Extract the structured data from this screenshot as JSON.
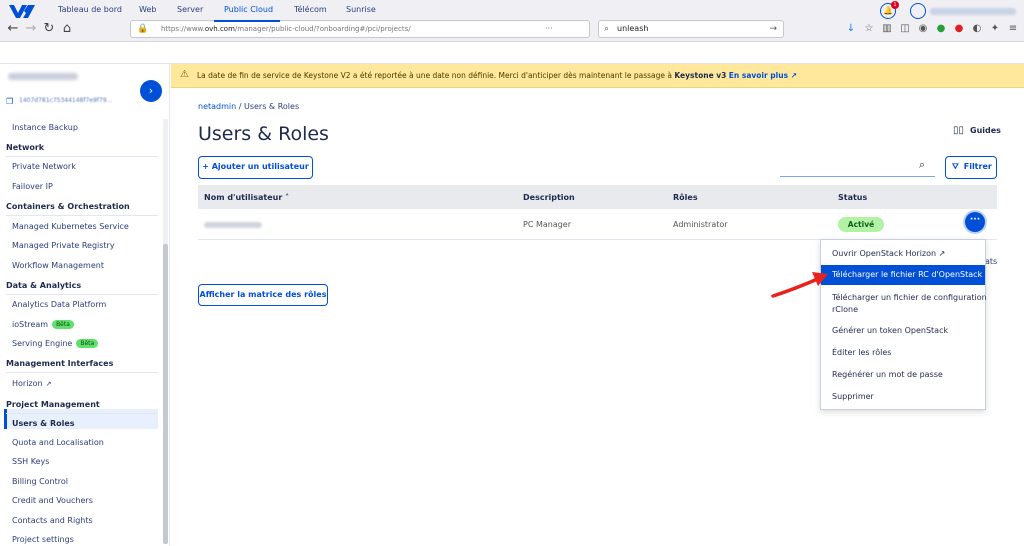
{
  "browser": {
    "url_prefix": "https://www.",
    "url_domain": "ovh.com",
    "url_rest": "/manager/public-cloud/?onboarding#/pci/projects/",
    "url_tail": "···",
    "search_value": "unleash"
  },
  "topnav": {
    "items": [
      "Tableau de bord",
      "Web",
      "Server",
      "Public Cloud",
      "Télécom",
      "Sunrise"
    ],
    "notif_count": "1"
  },
  "sidebar": {
    "toggle": "›",
    "project_id": "1407d781c75344148f7e9f79...",
    "items": [
      {
        "type": "item",
        "label": "Instance Backup"
      },
      {
        "type": "section",
        "label": "Network"
      },
      {
        "type": "item",
        "label": "Private Network"
      },
      {
        "type": "item",
        "label": "Failover IP"
      },
      {
        "type": "section",
        "label": "Containers & Orchestration"
      },
      {
        "type": "item",
        "label": "Managed Kubernetes Service"
      },
      {
        "type": "item",
        "label": "Managed Private Registry"
      },
      {
        "type": "item",
        "label": "Workflow Management"
      },
      {
        "type": "section",
        "label": "Data & Analytics"
      },
      {
        "type": "item",
        "label": "Analytics Data Platform"
      },
      {
        "type": "item",
        "label": "ioStream",
        "badge": "Bêta"
      },
      {
        "type": "item",
        "label": "Serving Engine",
        "badge": "Bêta"
      },
      {
        "type": "section",
        "label": "Management Interfaces"
      },
      {
        "type": "item",
        "label": "Horizon",
        "external": "↗"
      },
      {
        "type": "section",
        "label": "Project Management"
      },
      {
        "type": "item",
        "label": "Users & Roles",
        "active": true
      },
      {
        "type": "item",
        "label": "Quota and Localisation"
      },
      {
        "type": "item",
        "label": "SSH Keys"
      },
      {
        "type": "item",
        "label": "Billing Control"
      },
      {
        "type": "item",
        "label": "Credit and Vouchers"
      },
      {
        "type": "item",
        "label": "Contacts and Rights"
      },
      {
        "type": "item",
        "label": "Project settings"
      }
    ]
  },
  "banner": {
    "icon": "⚠",
    "text": "La date de fin de service de Keystone V2 a été reportée à une date non définie. Merci d'anticiper dès maintenant le passage à ",
    "strong": "Keystone v3",
    "link": "En savoir plus ↗"
  },
  "main": {
    "breadcrumb_link": "netadmin",
    "breadcrumb_sep": " / ",
    "breadcrumb_current": "Users & Roles",
    "title": "Users & Roles",
    "guides": "Guides",
    "add_user": "+ Ajouter un utilisateur",
    "filter": "Filtrer",
    "roles_matrix": "Afficher la matrice des rôles",
    "partial_text": "ats"
  },
  "table": {
    "columns": [
      "Nom d'utilisateur ˄",
      "Description",
      "Rôles",
      "Status"
    ],
    "rows": [
      {
        "description": "PC Manager",
        "roles": "Administrator",
        "status": "Activé",
        "actions": "···"
      }
    ]
  },
  "menu": {
    "items": [
      "Ouvrir OpenStack Horizon ↗",
      "Télécharger le fichier RC d'OpenStack",
      "Télécharger un fichier de configuration",
      "rClone",
      "Générer un token OpenStack",
      "Éditer les rôles",
      "Regénérer un mot de passe",
      "Supprimer"
    ],
    "highlight_index": 1
  },
  "colors": {
    "accent": "#0050d7",
    "banner": "#ffe89c",
    "status_ok": "#b2f2a5",
    "annotation": "#e8221c"
  }
}
